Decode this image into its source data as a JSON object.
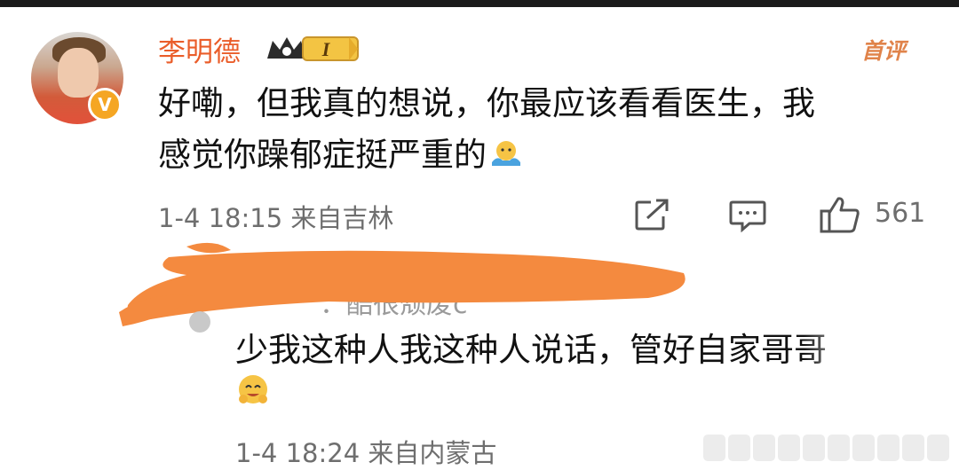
{
  "comment": {
    "username": "李明德",
    "vip_level": "I",
    "tag": "首评",
    "text_line1": "好嘞，但我真的想说，你最应该看看医生，我",
    "text_line2": "感觉你躁郁症挺严重的",
    "emoji": "facepalm-emoji",
    "meta": "1-4 18:15 来自吉林",
    "like_count": "561"
  },
  "reply": {
    "hidden_name_fragment": "：酷很颓废c",
    "text": "少我这种人我这种人说话，管好自家哥哥",
    "emoji": "hug-emoji",
    "meta": "1-4 18:24 来自内蒙古"
  },
  "colors": {
    "username": "#ea5d2a",
    "tag": "#e0834a",
    "meta": "#6e6e6e",
    "redaction": "#f48a3f",
    "badge": "#f5a623"
  }
}
